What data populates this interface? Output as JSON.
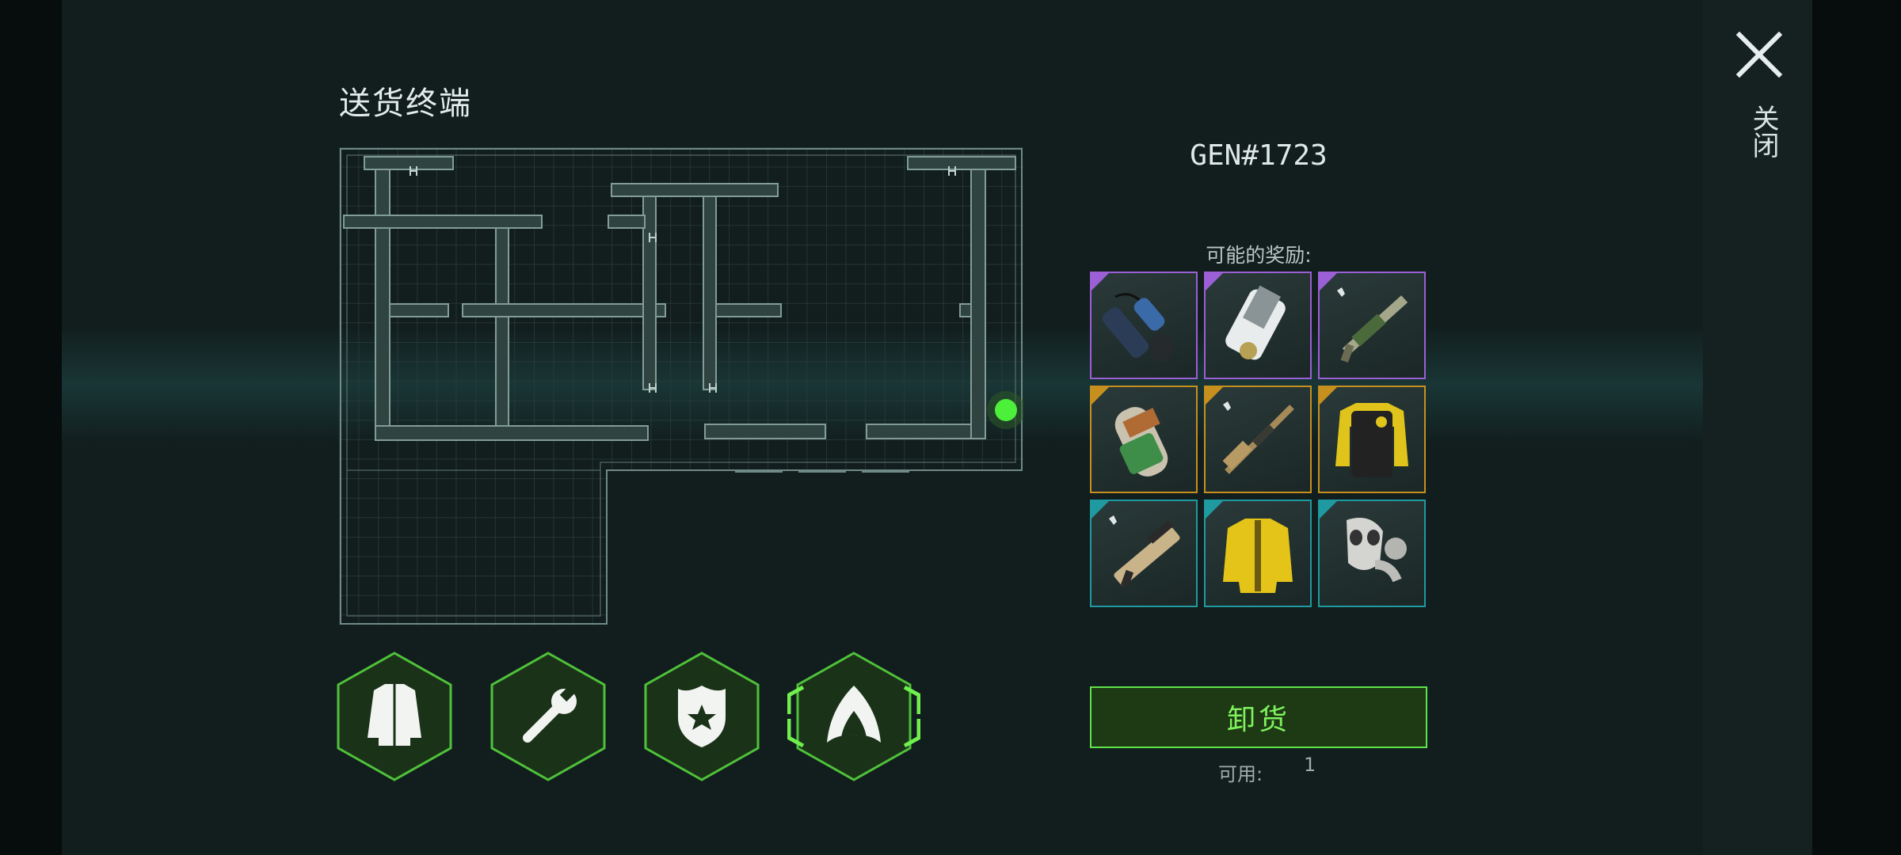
{
  "header": {
    "title": "送货终端"
  },
  "panel": {
    "gen_code": "GEN#1723",
    "rewards_label": "可能的奖励:",
    "unload_label": "卸货",
    "available_label": "可用:",
    "available_value": "1"
  },
  "close": {
    "label": "关闭",
    "icon": "close-icon"
  },
  "rewards": [
    {
      "name": "scope-attachment",
      "rarity": "epic"
    },
    {
      "name": "tablet-device",
      "rarity": "epic"
    },
    {
      "name": "assault-rifle",
      "rarity": "epic"
    },
    {
      "name": "gas-canister",
      "rarity": "legendary"
    },
    {
      "name": "shotgun",
      "rarity": "legendary"
    },
    {
      "name": "armored-vest-yellow",
      "rarity": "legendary"
    },
    {
      "name": "bullpup-rifle",
      "rarity": "rare"
    },
    {
      "name": "yellow-jacket",
      "rarity": "rare"
    },
    {
      "name": "gas-mask",
      "rarity": "rare"
    }
  ],
  "categories": [
    {
      "name": "clothing-category",
      "icon": "jacket-icon",
      "selected": false
    },
    {
      "name": "tools-category",
      "icon": "wrench-icon",
      "selected": false
    },
    {
      "name": "police-category",
      "icon": "badge-icon",
      "selected": false
    },
    {
      "name": "special-category",
      "icon": "arch-icon",
      "selected": true
    }
  ],
  "colors": {
    "epic": "#9b5fd6",
    "legendary": "#c7901e",
    "rare": "#1f9aa0",
    "accent_green": "#5fe34a",
    "marker_green": "#4cf03a"
  }
}
